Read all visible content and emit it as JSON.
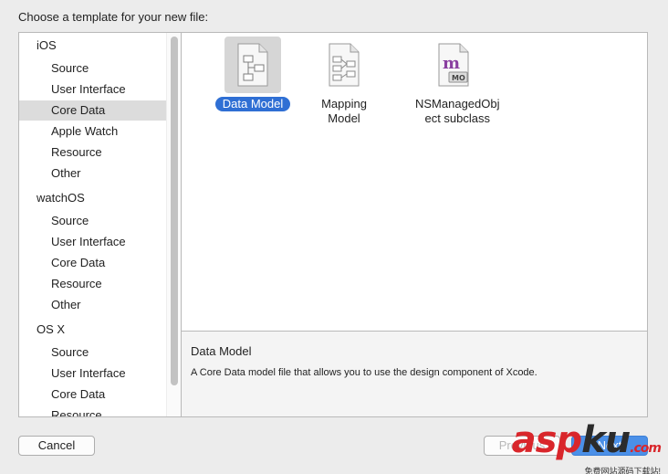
{
  "dialog": {
    "title": "Choose a template for your new file:"
  },
  "sidebar": {
    "groups": [
      {
        "name": "iOS",
        "items": [
          "Source",
          "User Interface",
          "Core Data",
          "Apple Watch",
          "Resource",
          "Other"
        ]
      },
      {
        "name": "watchOS",
        "items": [
          "Source",
          "User Interface",
          "Core Data",
          "Resource",
          "Other"
        ]
      },
      {
        "name": "OS X",
        "items": [
          "Source",
          "User Interface",
          "Core Data",
          "Resource"
        ]
      }
    ],
    "selected": "iOS / Core Data"
  },
  "templates": [
    {
      "label": "Data Model",
      "icon": "data-model-icon",
      "selected": true
    },
    {
      "label": "Mapping Model",
      "icon": "mapping-model-icon",
      "selected": false
    },
    {
      "label_line1": "NSManagedObj",
      "label_line2": "ect subclass",
      "icon": "managed-object-icon",
      "badge": "MO",
      "glyph": "m",
      "selected": false
    }
  ],
  "details": {
    "name": "Data Model",
    "description": "A Core Data model file that allows you to use the design component of Xcode."
  },
  "buttons": {
    "cancel": "Cancel",
    "previous": "Previous",
    "next": "Next"
  },
  "watermark": {
    "brand_red": "asp",
    "brand_dark": "ku",
    "brand_tld": ".com",
    "tagline": "免费网站源码下载站!"
  },
  "colors": {
    "selection_blue": "#2f6fd4",
    "primary_button": "#4b90e8",
    "watermark_red": "#d9262b"
  }
}
